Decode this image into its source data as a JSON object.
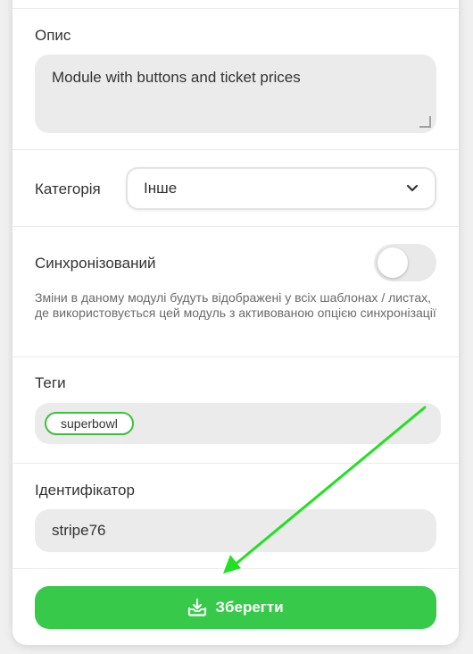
{
  "form": {
    "description": {
      "label": "Опис",
      "value": "Module with buttons and ticket prices"
    },
    "category": {
      "label": "Категорія",
      "selected": "Інше"
    },
    "sync": {
      "label": "Синхронізований",
      "enabled": false,
      "hint": "Зміни в даному модулі будуть відображені у всіх шаблонах / листах, де використовується цей модуль з активованою опцією синхронізації"
    },
    "tags": {
      "label": "Теги",
      "items": [
        "superbowl"
      ]
    },
    "identifier": {
      "label": "Ідентифікатор",
      "value": "stripe76"
    },
    "save_label": "Зберегти"
  },
  "colors": {
    "accent": "#36c94a",
    "tag_border": "#3cc13c",
    "annotation_arrow": "#22e022"
  },
  "icons": [
    "resize-handle-icon",
    "chevron-down-icon",
    "download-icon"
  ]
}
